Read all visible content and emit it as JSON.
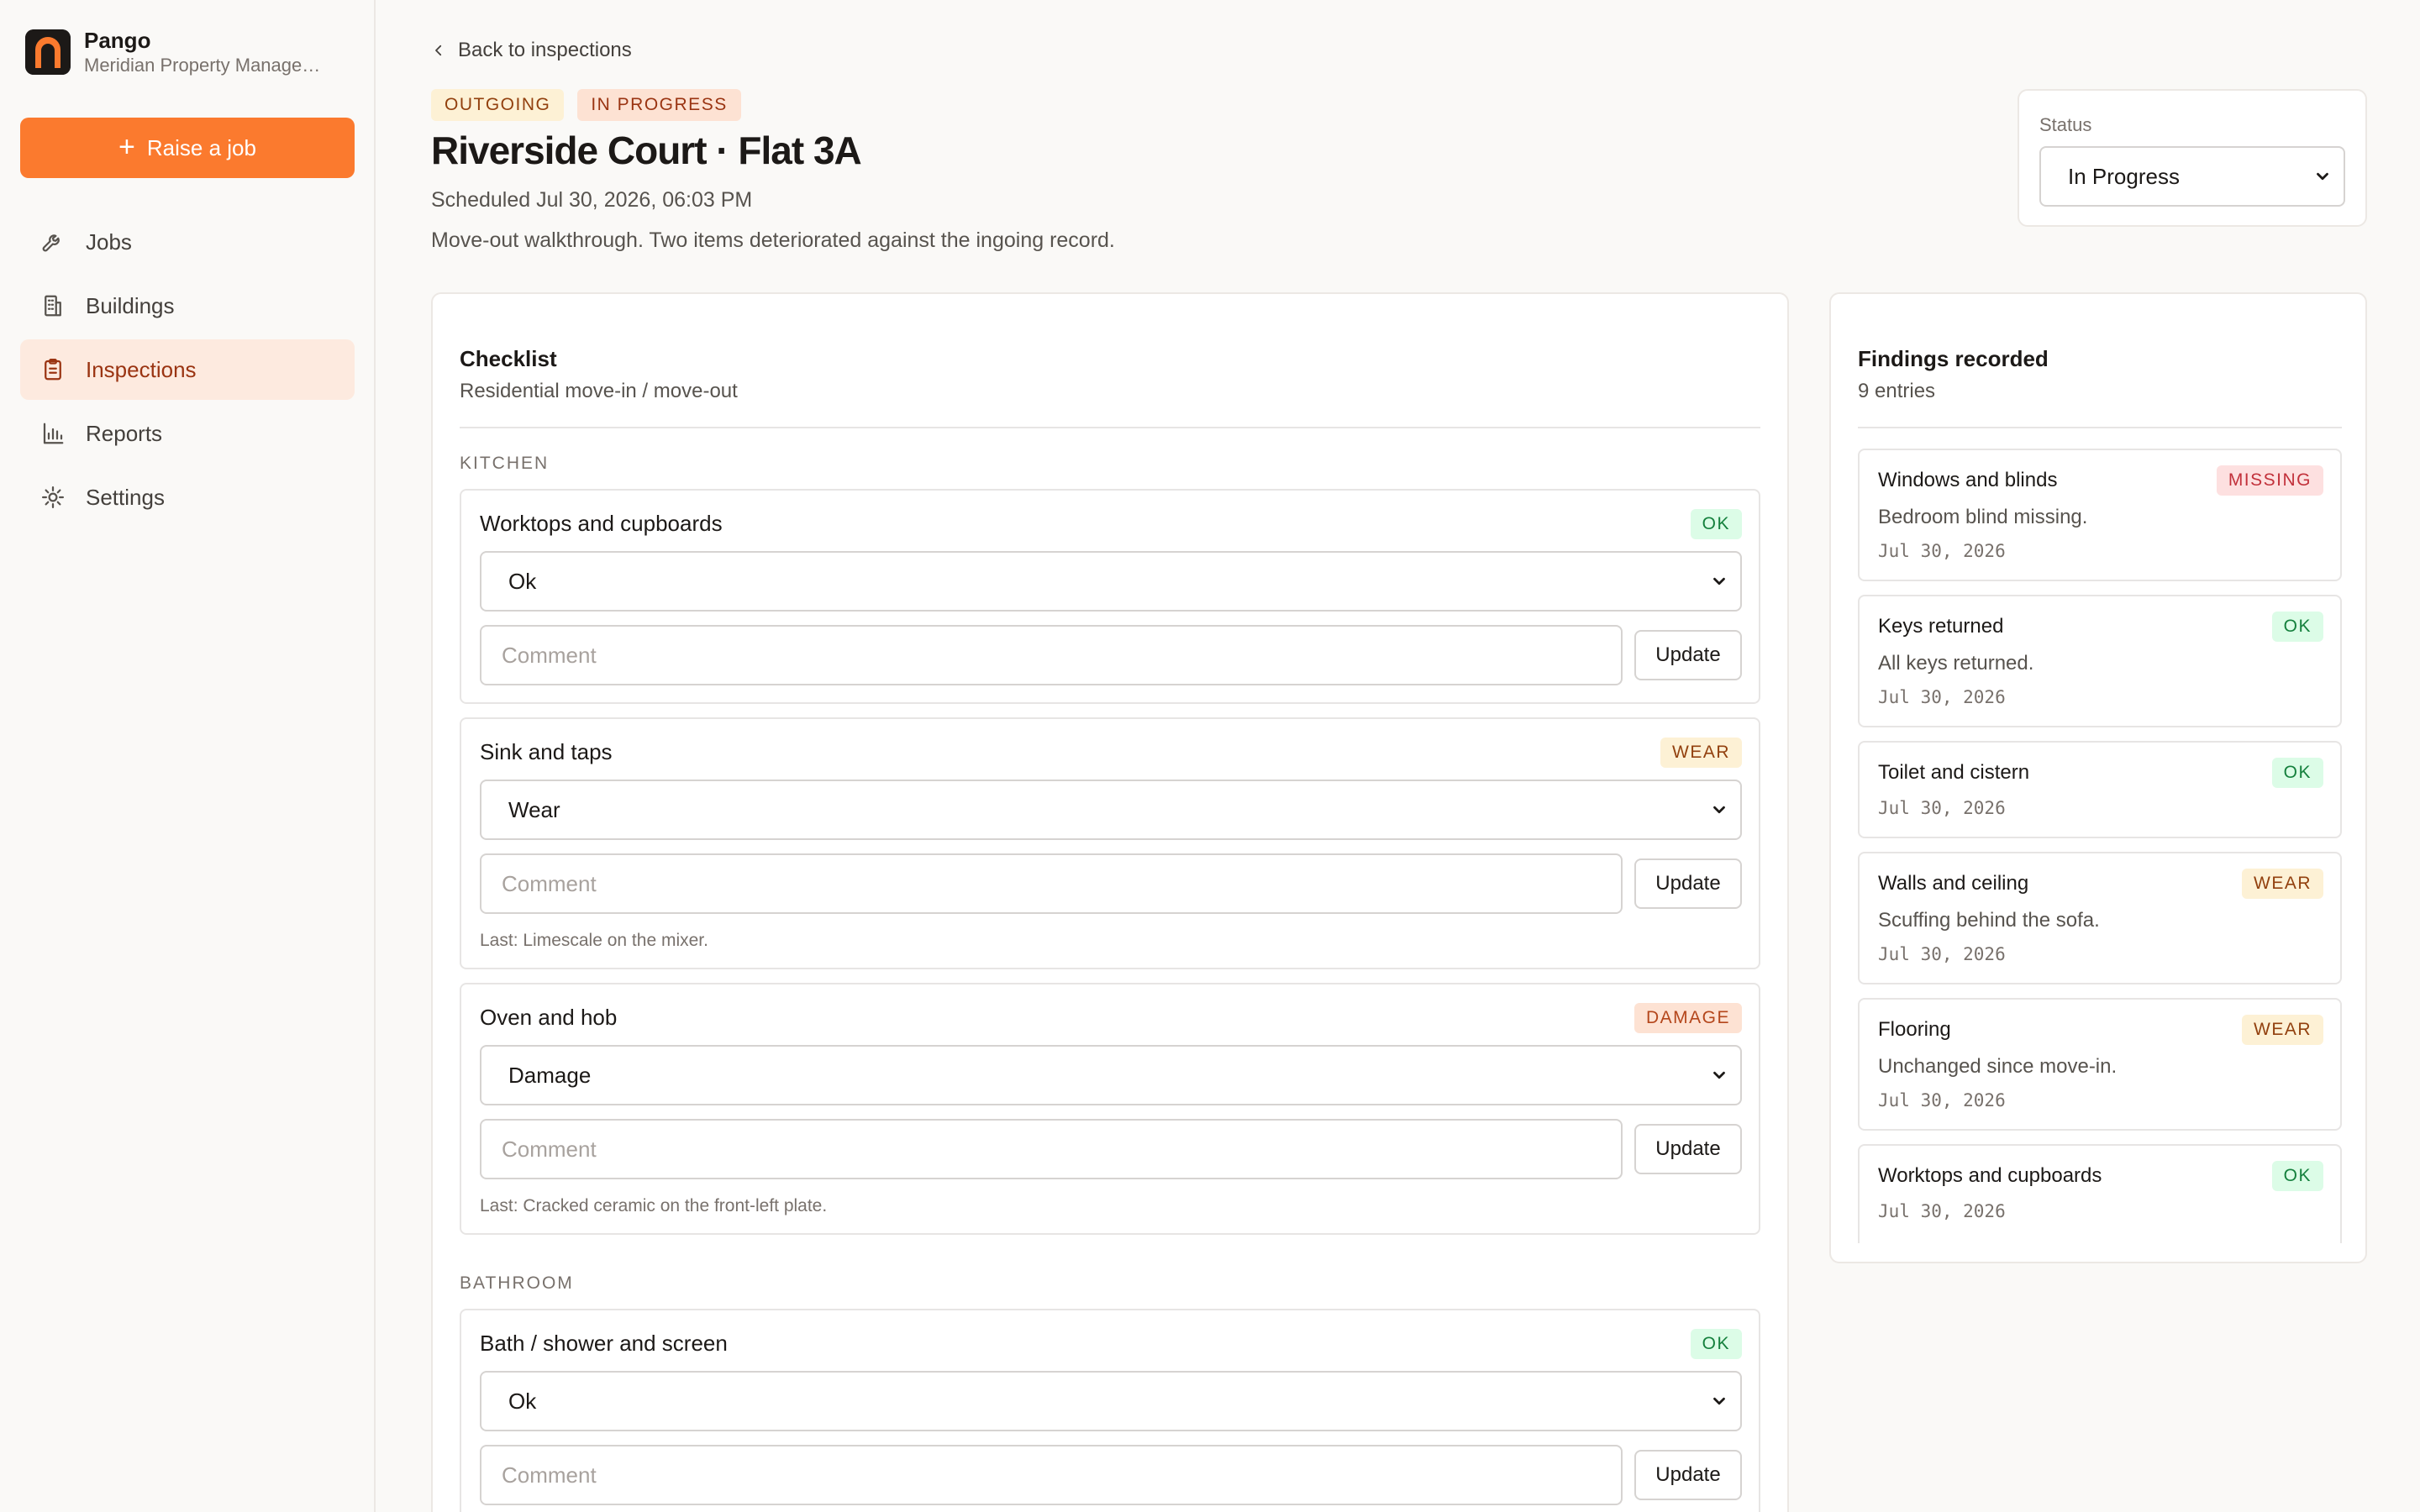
{
  "brand": {
    "name": "Pango",
    "org": "Meridian Property Manage…"
  },
  "sidebar": {
    "raise_label": "Raise a job",
    "items": [
      {
        "label": "Jobs",
        "icon": "wrench-icon",
        "active": false
      },
      {
        "label": "Buildings",
        "icon": "building-icon",
        "active": false
      },
      {
        "label": "Inspections",
        "icon": "clipboard-icon",
        "active": true
      },
      {
        "label": "Reports",
        "icon": "bar-chart-icon",
        "active": false
      },
      {
        "label": "Settings",
        "icon": "gear-icon",
        "active": false
      }
    ]
  },
  "header": {
    "back_label": "Back to inspections",
    "tags": [
      "OUTGOING",
      "IN PROGRESS"
    ],
    "title": "Riverside Court · Flat 3A",
    "scheduled": "Scheduled Jul 30, 2026, 06:03 PM",
    "description": "Move-out walkthrough. Two items deteriorated against the ingoing record."
  },
  "status": {
    "label": "Status",
    "value": "In Progress"
  },
  "checklist": {
    "title": "Checklist",
    "subtitle": "Residential move-in / move-out",
    "comment_placeholder": "Comment",
    "update_label": "Update",
    "sections": [
      {
        "label": "KITCHEN",
        "items": [
          {
            "name": "Worktops and cupboards",
            "badge": "OK",
            "condition": "Ok",
            "last": ""
          },
          {
            "name": "Sink and taps",
            "badge": "WEAR",
            "condition": "Wear",
            "last": "Last: Limescale on the mixer."
          },
          {
            "name": "Oven and hob",
            "badge": "DAMAGE",
            "condition": "Damage",
            "last": "Last: Cracked ceramic on the front-left plate."
          }
        ]
      },
      {
        "label": "BATHROOM",
        "items": [
          {
            "name": "Bath / shower and screen",
            "badge": "OK",
            "condition": "Ok",
            "last": ""
          }
        ]
      }
    ]
  },
  "findings": {
    "title": "Findings recorded",
    "count": "9 entries",
    "entries": [
      {
        "name": "Windows and blinds",
        "badge": "MISSING",
        "note": "Bedroom blind missing.",
        "date": "Jul 30, 2026"
      },
      {
        "name": "Keys returned",
        "badge": "OK",
        "note": "All keys returned.",
        "date": "Jul 30, 2026"
      },
      {
        "name": "Toilet and cistern",
        "badge": "OK",
        "note": "",
        "date": "Jul 30, 2026"
      },
      {
        "name": "Walls and ceiling",
        "badge": "WEAR",
        "note": "Scuffing behind the sofa.",
        "date": "Jul 30, 2026"
      },
      {
        "name": "Flooring",
        "badge": "WEAR",
        "note": "Unchanged since move-in.",
        "date": "Jul 30, 2026"
      },
      {
        "name": "Worktops and cupboards",
        "badge": "OK",
        "note": "",
        "date": "Jul 30, 2026"
      }
    ]
  },
  "colors": {
    "accent": "#fb7a2e",
    "active_nav_bg": "#fdeadf",
    "ok": "#15803d",
    "wear": "#92400e",
    "damage": "#b4461b",
    "missing": "#c2313b"
  }
}
